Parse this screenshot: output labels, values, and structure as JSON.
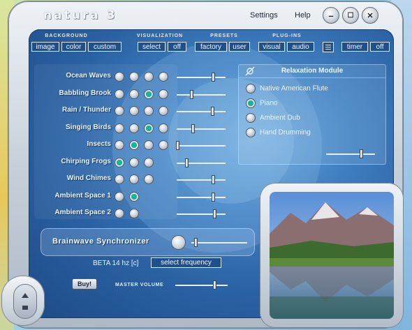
{
  "app": {
    "logo": "natura 3",
    "menu": {
      "settings": "Settings",
      "help": "Help"
    },
    "window_buttons": {
      "minimize": "–",
      "maximize": "☐",
      "close": "✕"
    }
  },
  "toolbar": {
    "background": {
      "label": "BACKGROUND",
      "buttons": [
        "image",
        "color",
        "custom"
      ]
    },
    "visualization": {
      "label": "VISUALIZATION",
      "buttons": [
        "select",
        "off"
      ]
    },
    "presets": {
      "label": "PRESETS",
      "buttons": [
        "factory",
        "user"
      ]
    },
    "plugins": {
      "label": "PLUG-INS",
      "buttons": [
        "visual",
        "audio"
      ]
    },
    "timer": {
      "buttons": [
        "timer",
        "off"
      ]
    }
  },
  "sounds": [
    {
      "name": "Ocean Waves",
      "orbs": 4,
      "active": -1,
      "volume": 0.74
    },
    {
      "name": "Babbling Brook",
      "orbs": 4,
      "active": 2,
      "volume": 0.3
    },
    {
      "name": "Rain / Thunder",
      "orbs": 4,
      "active": -1,
      "volume": 0.73
    },
    {
      "name": "Singing Birds",
      "orbs": 4,
      "active": 2,
      "volume": 0.33
    },
    {
      "name": "Insects",
      "orbs": 4,
      "active": 1,
      "volume": 0.02
    },
    {
      "name": "Chirping Frogs",
      "orbs": 3,
      "active": 0,
      "volume": 0.2
    },
    {
      "name": "Wind Chimes",
      "orbs": 3,
      "active": -1,
      "volume": 0.74
    },
    {
      "name": "Ambient Space 1",
      "orbs": 2,
      "active": 1,
      "volume": 0.74
    },
    {
      "name": "Ambient Space 2",
      "orbs": 2,
      "active": -1,
      "volume": 0.77
    }
  ],
  "relaxation": {
    "title": "Relaxation Module",
    "options": [
      "Native American Flute",
      "Piano",
      "Ambient Dub",
      "Hand Drumming"
    ],
    "selected": 1,
    "volume": 0.72
  },
  "brainwave": {
    "title": "Brainwave Synchronizer",
    "frequency_text": "BETA 14 hz [c]",
    "select_label": "select frequency",
    "volume": 0.08
  },
  "buy_label": "Buy!",
  "master": {
    "label": "MASTER VOLUME",
    "volume": 0.74
  },
  "colors": {
    "panel": "#2b62a4",
    "active_orb": "#1db39a",
    "frame": "#c7d0da"
  }
}
